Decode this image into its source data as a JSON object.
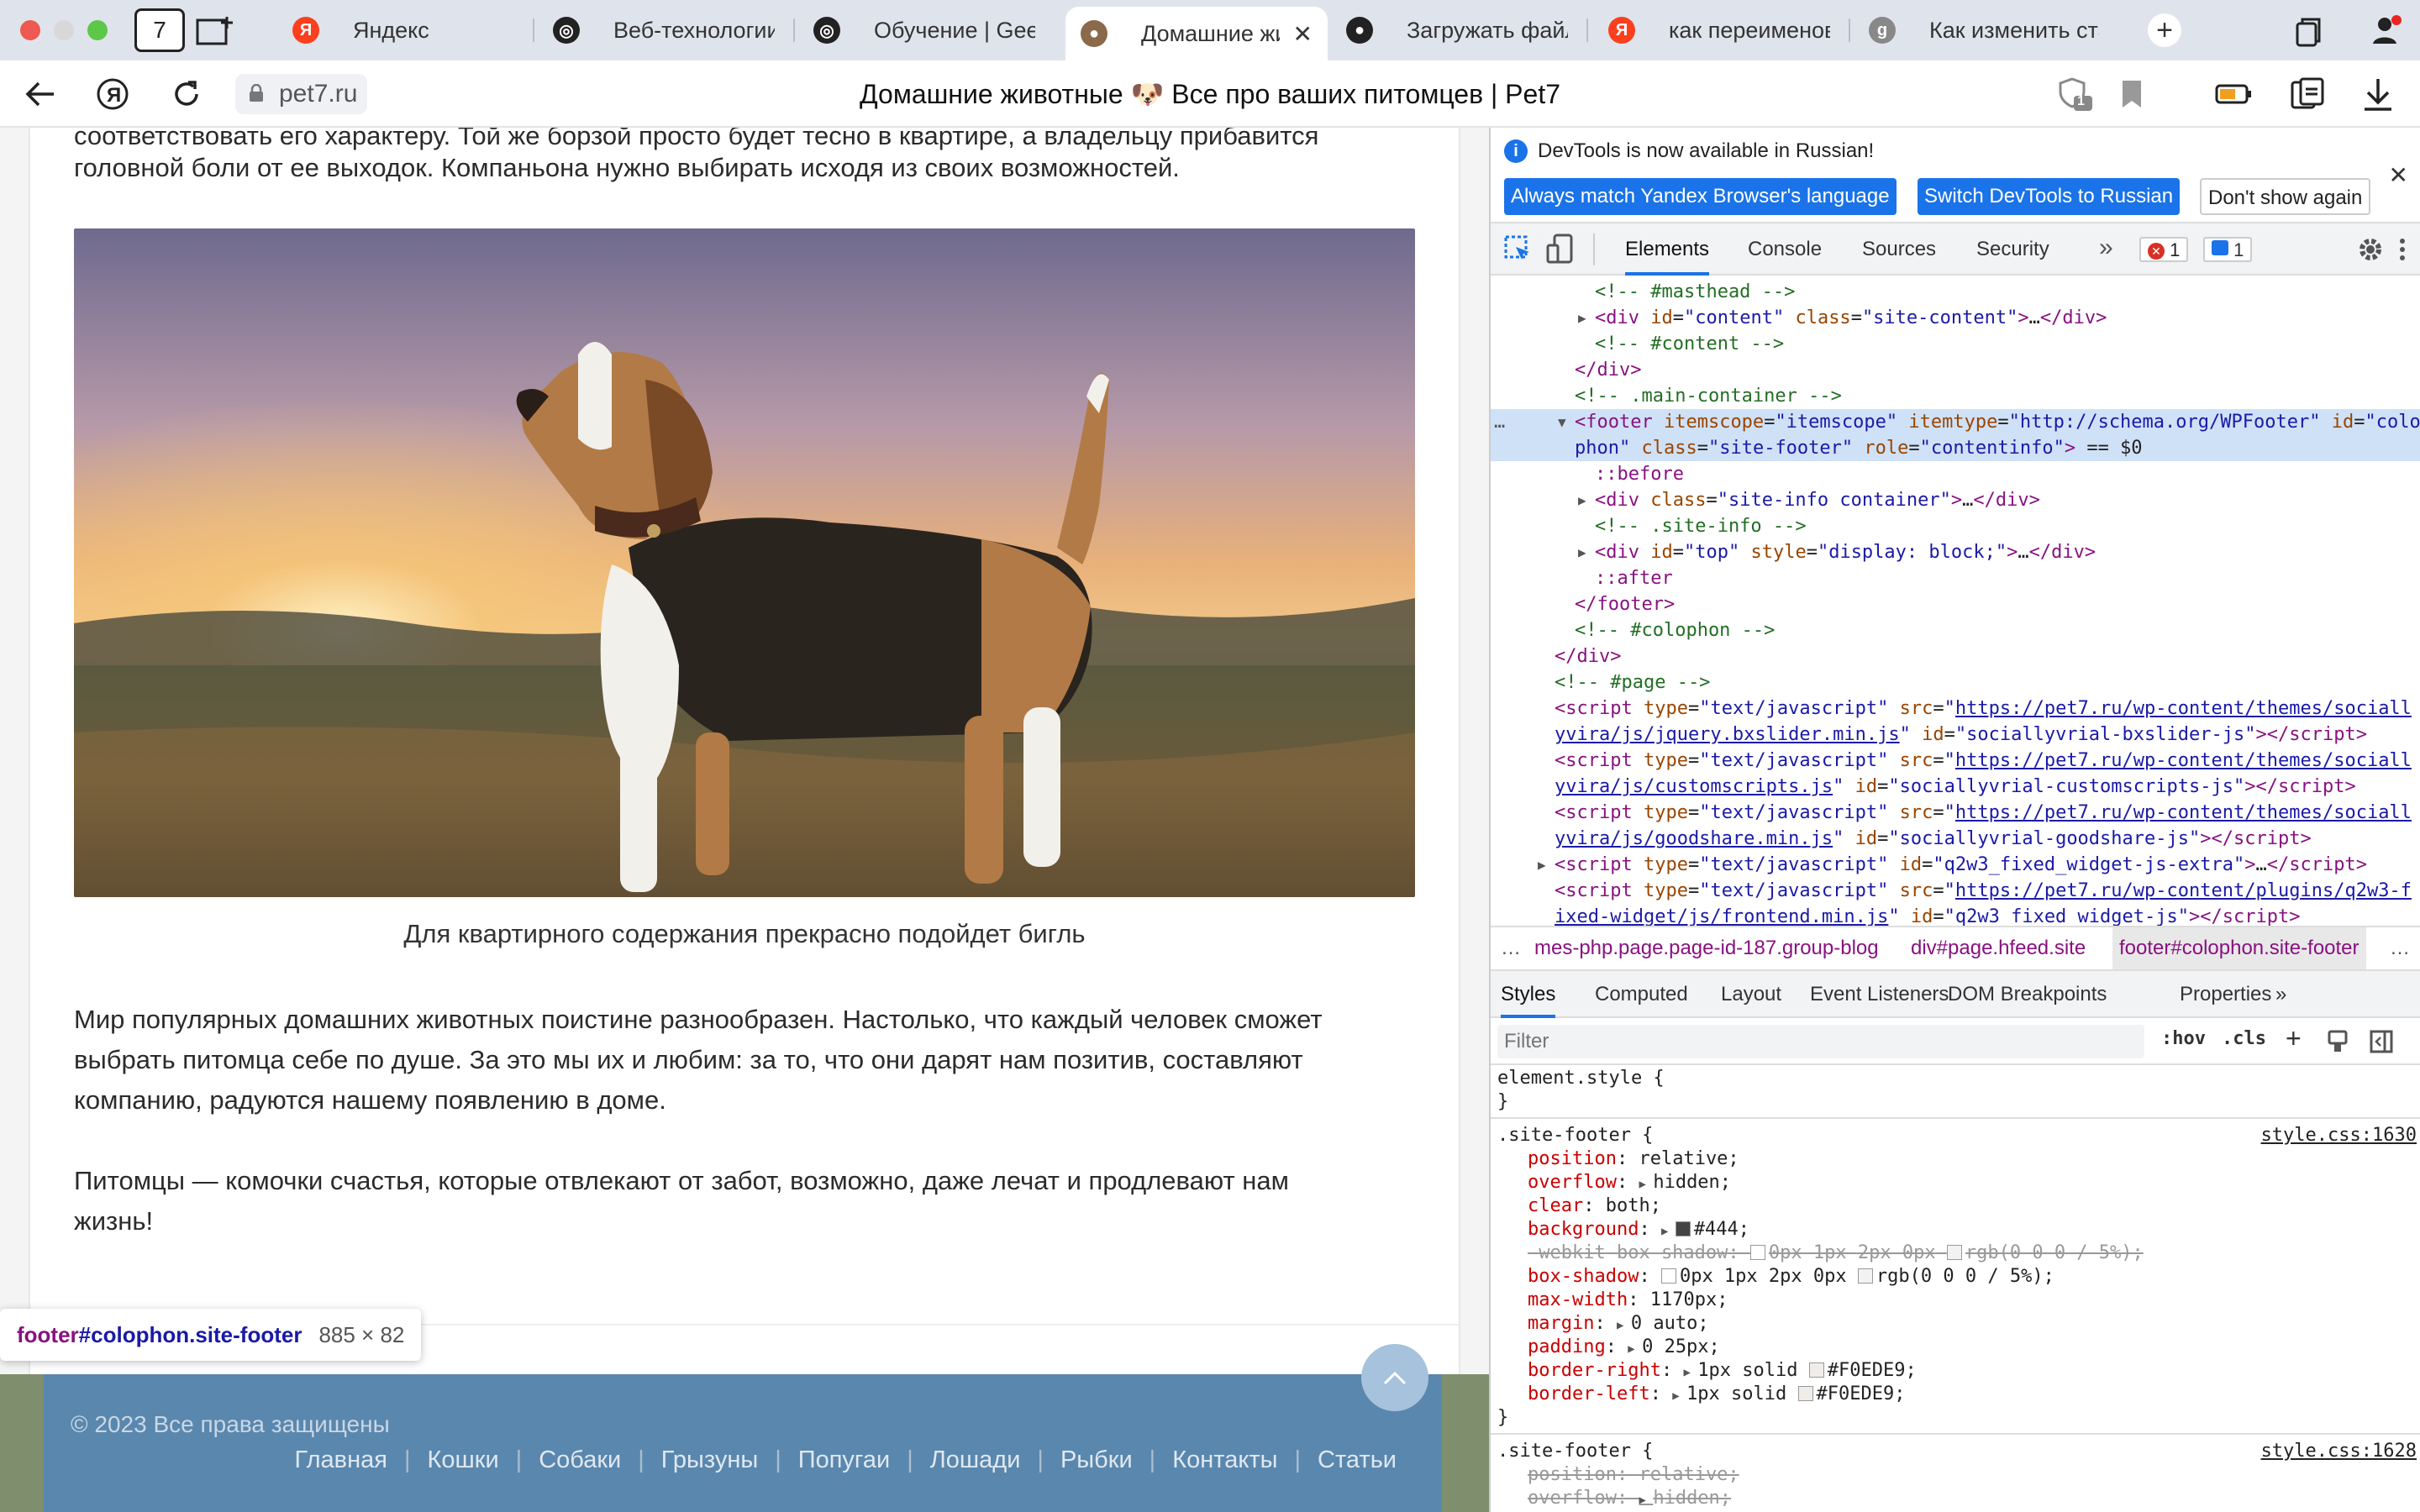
{
  "colors": {
    "accent": "#1a73e8",
    "footer_bg": "#5a87ad",
    "tab_strip": "#dfe4ec"
  },
  "tabstrip": {
    "tabs": [
      {
        "title": "Яндекс",
        "icon": "yandex-icon"
      },
      {
        "title": "Веб-технологии:",
        "icon": "openai-icon"
      },
      {
        "title": "Обучение | GeekE",
        "icon": "openai-icon"
      },
      {
        "title": "Домашние живо",
        "icon": "pug-icon",
        "active": true
      },
      {
        "title": "Загружать файлы",
        "icon": "github-icon"
      },
      {
        "title": "как переименова",
        "icon": "yandex-icon"
      },
      {
        "title": "Как изменить ста",
        "icon": "g-icon"
      }
    ],
    "home_badge": "7",
    "new_tab": "+"
  },
  "addressbar": {
    "url": "pet7.ru",
    "title": "Домашние животные 🐶 Все про ваших питомцев | Pet7",
    "shield_badge": "1"
  },
  "page": {
    "top_text_1": "соответствовать его характеру. Той же борзой просто будет тесно в квартире, а владельцу прибавится",
    "top_text_2": "головной боли от ее выходок. Компаньона нужно выбирать исходя из своих возможностей.",
    "caption": "Для квартирного содержания прекрасно подойдет бигль",
    "para1_l1": "Мир популярных домашних животных поистине разнообразен. Настолько, что каждый человек сможет",
    "para1_l2": "выбрать питомца себе по душе. За это мы их и любим: за то, что они дарят нам позитив, составляют",
    "para1_l3": "компанию, радуются нашему появлению в доме.",
    "para2_l1": "Питомцы — комочки счастья, которые отвлекают от забот, возможно, даже лечат и продлевают нам",
    "para2_l2": "жизнь!",
    "copyright": "© 2023 Все права защищены",
    "nav": [
      "Главная",
      "Кошки",
      "Собаки",
      "Грызуны",
      "Попугаи",
      "Лошади",
      "Рыбки",
      "Контакты",
      "Статьи"
    ],
    "tooltip": {
      "tag": "footer",
      "selector": "#colophon.site-footer",
      "size": "885 × 82"
    }
  },
  "devtools": {
    "info": "DevTools is now available in Russian!",
    "btn_match": "Always match Yandex Browser's language",
    "btn_switch": "Switch DevTools to Russian",
    "btn_dont": "Don't show again",
    "tabs": [
      "Elements",
      "Console",
      "Sources",
      "Security"
    ],
    "more": "»",
    "errors": "1",
    "messages": "1",
    "breadcrumb": [
      "…",
      "mes-php.page.page-id-187.group-blog",
      "div#page.hfeed.site",
      "footer#colophon.site-footer",
      "…"
    ],
    "style_tabs": [
      "Styles",
      "Computed",
      "Layout",
      "Event Listeners",
      "DOM Breakpoints",
      "Properties",
      "»"
    ],
    "filter_placeholder": "Filter",
    "hov": ":hov",
    "cls": ".cls",
    "dom": [
      {
        "i": 1,
        "html": "<span class='cm'>&lt;!-- #masthead --&gt;</span>"
      },
      {
        "i": 1,
        "tri": "▶",
        "html": "<span class='tg'>&lt;div</span> <span class='at'>id</span>=<span class='av'>\"content\"</span> <span class='at'>class</span>=<span class='av'>\"site-content\"</span><span class='tg'>&gt;</span>…<span class='tg'>&lt;/div&gt;</span>"
      },
      {
        "i": 1,
        "html": "<span class='cm'>&lt;!-- #content --&gt;</span>"
      },
      {
        "i": 0,
        "html": "<span class='tg'>&lt;/div&gt;</span>"
      },
      {
        "i": 0,
        "html": "<span class='cm'>&lt;!-- .main-container --&gt;</span>"
      },
      {
        "i": 0,
        "tri": "▼",
        "sel": true,
        "html": "<span class='tg'>&lt;footer</span> <span class='at'>itemscope</span>=<span class='av'>\"itemscope\"</span> <span class='at'>itemtype</span>=<span class='av'>\"http://schema.org/WPFooter\"</span> <span class='at'>id</span>=<span class='av'>\"colo</span>"
      },
      {
        "i": 0,
        "sel": true,
        "html": "<span class='av'>phon\"</span> <span class='at'>class</span>=<span class='av'>\"site-footer\"</span> <span class='at'>role</span>=<span class='av'>\"contentinfo\"</span><span class='tg'>&gt;</span> <span class='pl'>== $0</span>"
      },
      {
        "i": 1,
        "html": "<span class='ps'>::before</span>"
      },
      {
        "i": 1,
        "tri": "▶",
        "html": "<span class='tg'>&lt;div</span> <span class='at'>class</span>=<span class='av'>\"site-info container\"</span><span class='tg'>&gt;</span>…<span class='tg'>&lt;/div&gt;</span>"
      },
      {
        "i": 1,
        "html": "<span class='cm'>&lt;!-- .site-info --&gt;</span>"
      },
      {
        "i": 1,
        "tri": "▶",
        "html": "<span class='tg'>&lt;div</span> <span class='at'>id</span>=<span class='av'>\"top\"</span> <span class='at'>style</span>=<span class='av'>\"display: block;\"</span><span class='tg'>&gt;</span>…<span class='tg'>&lt;/div&gt;</span>"
      },
      {
        "i": 1,
        "html": "<span class='ps'>::after</span>"
      },
      {
        "i": 0,
        "html": "<span class='tg'>&lt;/footer&gt;</span>"
      },
      {
        "i": 0,
        "html": "<span class='cm'>&lt;!-- #colophon --&gt;</span>"
      },
      {
        "i": -1,
        "html": "<span class='tg'>&lt;/div&gt;</span>"
      },
      {
        "i": -1,
        "html": "<span class='cm'>&lt;!-- #page --&gt;</span>"
      },
      {
        "i": -1,
        "html": "<span class='tg'>&lt;script</span> <span class='at'>type</span>=<span class='av'>\"text/javascript\"</span> <span class='at'>src</span>=<span class='av'>\"</span><span class='lk'>https://pet7.ru/wp-content/themes/sociall</span>"
      },
      {
        "i": -1,
        "html": "<span class='lk'>yvira/js/jquery.bxslider.min.js</span><span class='av'>\"</span> <span class='at'>id</span>=<span class='av'>\"sociallyvrial-bxslider-js\"</span><span class='tg'>&gt;&lt;/script&gt;</span>"
      },
      {
        "i": -1,
        "html": "<span class='tg'>&lt;script</span> <span class='at'>type</span>=<span class='av'>\"text/javascript\"</span> <span class='at'>src</span>=<span class='av'>\"</span><span class='lk'>https://pet7.ru/wp-content/themes/sociall</span>"
      },
      {
        "i": -1,
        "html": "<span class='lk'>yvira/js/customscripts.js</span><span class='av'>\"</span> <span class='at'>id</span>=<span class='av'>\"sociallyvrial-customscripts-js\"</span><span class='tg'>&gt;&lt;/script&gt;</span>"
      },
      {
        "i": -1,
        "html": "<span class='tg'>&lt;script</span> <span class='at'>type</span>=<span class='av'>\"text/javascript\"</span> <span class='at'>src</span>=<span class='av'>\"</span><span class='lk'>https://pet7.ru/wp-content/themes/sociall</span>"
      },
      {
        "i": -1,
        "html": "<span class='lk'>yvira/js/goodshare.min.js</span><span class='av'>\"</span> <span class='at'>id</span>=<span class='av'>\"sociallyvrial-goodshare-js\"</span><span class='tg'>&gt;&lt;/script&gt;</span>"
      },
      {
        "i": -1,
        "tri": "▶",
        "html": "<span class='tg'>&lt;script</span> <span class='at'>type</span>=<span class='av'>\"text/javascript\"</span> <span class='at'>id</span>=<span class='av'>\"q2w3_fixed_widget-js-extra\"</span><span class='tg'>&gt;</span>…<span class='tg'>&lt;/script&gt;</span>"
      },
      {
        "i": -1,
        "html": "<span class='tg'>&lt;script</span> <span class='at'>type</span>=<span class='av'>\"text/javascript\"</span> <span class='at'>src</span>=<span class='av'>\"</span><span class='lk'>https://pet7.ru/wp-content/plugins/q2w3-f</span>"
      },
      {
        "i": -1,
        "html": "<span class='lk'>ixed-widget/js/frontend.min.js</span><span class='av'>\"</span> <span class='at'>id</span>=<span class='av'>\"q2w3_fixed_widget-js\"</span><span class='tg'>&gt;&lt;/script&gt;</span>"
      }
    ],
    "styles": [
      {
        "t": "sel",
        "text": "element.style {"
      },
      {
        "t": "close",
        "text": "}"
      },
      {
        "t": "sep"
      },
      {
        "t": "sel",
        "text": ".site-footer {",
        "src": "style.css:1630"
      },
      {
        "t": "p",
        "prop": "position",
        "val": "relative;"
      },
      {
        "t": "p",
        "prop": "overflow",
        "val": "hidden;",
        "arrow": true
      },
      {
        "t": "p",
        "prop": "clear",
        "val": "both;"
      },
      {
        "t": "p",
        "prop": "background",
        "val": "#444;",
        "arrow": true,
        "swatch": "#444444"
      },
      {
        "t": "p",
        "prop": "-webkit-box-shadow",
        "val": "0px 1px 2px 0px",
        "strike": true,
        "shadow": true,
        "tail": "rgb(0 0 0 / 5%);"
      },
      {
        "t": "p",
        "prop": "box-shadow",
        "val": "0px 1px 2px 0px",
        "shadow": true,
        "tail": "rgb(0 0 0 / 5%);"
      },
      {
        "t": "p",
        "prop": "max-width",
        "val": "1170px;"
      },
      {
        "t": "p",
        "prop": "margin",
        "val": "0 auto;",
        "arrow": true
      },
      {
        "t": "p",
        "prop": "padding",
        "val": "0 25px;",
        "arrow": true
      },
      {
        "t": "p",
        "prop": "border-right",
        "val": "1px solid",
        "arrow": true,
        "swatch": "#F0EDE9",
        "tail": "#F0EDE9;"
      },
      {
        "t": "p",
        "prop": "border-left",
        "val": "1px solid",
        "arrow": true,
        "swatch": "#F0EDE9",
        "tail": "#F0EDE9;"
      },
      {
        "t": "close",
        "text": "}"
      },
      {
        "t": "sep"
      },
      {
        "t": "sel",
        "text": ".site-footer {",
        "src": "style.css:1628"
      },
      {
        "t": "p",
        "prop": "position",
        "val": "relative;",
        "strike": true
      },
      {
        "t": "p",
        "prop": "overflow",
        "val": "hidden;",
        "strike": true,
        "arrow": true
      }
    ]
  }
}
